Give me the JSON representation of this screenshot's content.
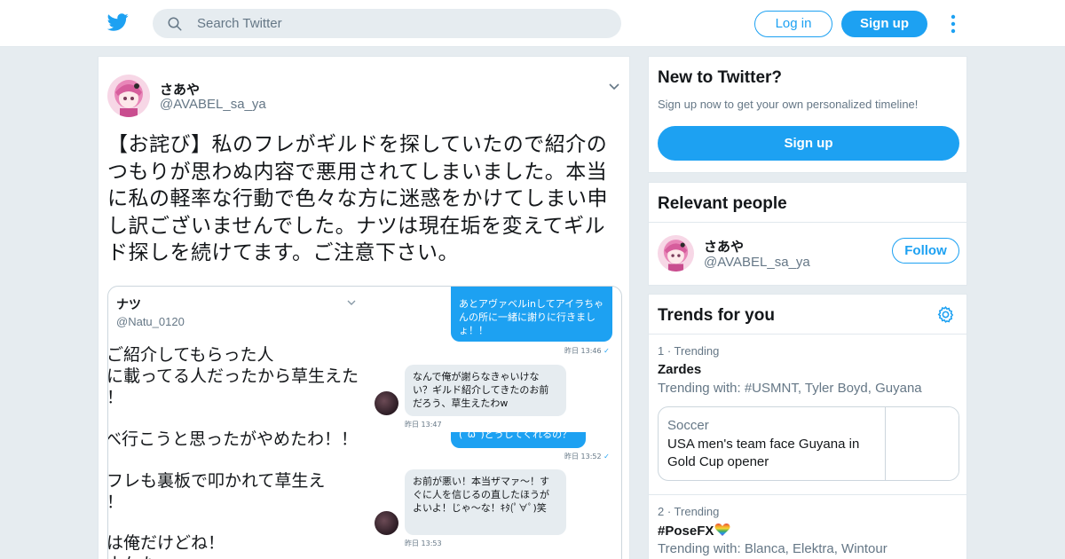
{
  "header": {
    "logo_icon": "twitter-bird-icon",
    "search_placeholder": "Search Twitter",
    "login_label": "Log in",
    "signup_label": "Sign up",
    "brand_color": "#1da1f2"
  },
  "tweet": {
    "name": "さあや",
    "handle": "@AVABEL_sa_ya",
    "text_lines": [
      "【お詫び】私のフレがギルドを探していたので紹介の",
      "つもりが思わぬ内容で悪用されてしまいました。本当",
      "に私の軽率な行動で色々な方に迷惑をかけてしまい申",
      "し訳ございませんでした。ナツは現在垢を変えてギル",
      "ド探しを続けてます。ご注意下さい。"
    ],
    "media": {
      "left": {
        "name": "ナツ",
        "handle": "@Natu_0120",
        "lines": [
          "ご紹介してもらった人",
          "に載ってる人だったから草生えた",
          "！",
          "べ行こうと思ったがやめたわ！！",
          "フレも裏板で叩かれて草生え",
          "！",
          "は俺だけどね！",
          "ウケた〜"
        ]
      },
      "chat": {
        "msg1": "あとアヴァベルinしてアイラちゃんの所に一緒に謝りに行きましょ！！",
        "ts1": "昨日 13:46",
        "msg2": "なんで俺が謝らなきゃいけない？ギルド紹介してきたのお前だろう、草生えたわw",
        "ts2": "昨日 13:47",
        "msg3": "(˘ω˘)どうしてくれるの？",
        "ts3": "昨日 13:52",
        "msg4": "お前が悪い！本当ザマァ〜！すぐに人を信じるの直したほうがよいよ！じゃ〜な！ｷﾀ(ﾟ∀ﾟ)笑",
        "ts4": "昨日 13:53",
        "check": "✓"
      }
    }
  },
  "new_to_twitter": {
    "title": "New to Twitter?",
    "subtitle": "Sign up now to get your own personalized timeline!",
    "button": "Sign up"
  },
  "relevant": {
    "title": "Relevant people",
    "name": "さあや",
    "handle": "@AVABEL_sa_ya",
    "follow": "Follow"
  },
  "trends": {
    "title": "Trends for you",
    "items": [
      {
        "meta": "1 · Trending",
        "name": "Zardes",
        "with": "Trending with: #USMNT, Tyler Boyd, Guyana",
        "card": {
          "category": "Soccer",
          "headline": "USA men's team face Guyana in Gold Cup opener"
        }
      },
      {
        "meta": "2 · Trending",
        "name": "#PoseFX",
        "with": "Trending with: Blanca, Elektra, Wintour"
      }
    ]
  }
}
